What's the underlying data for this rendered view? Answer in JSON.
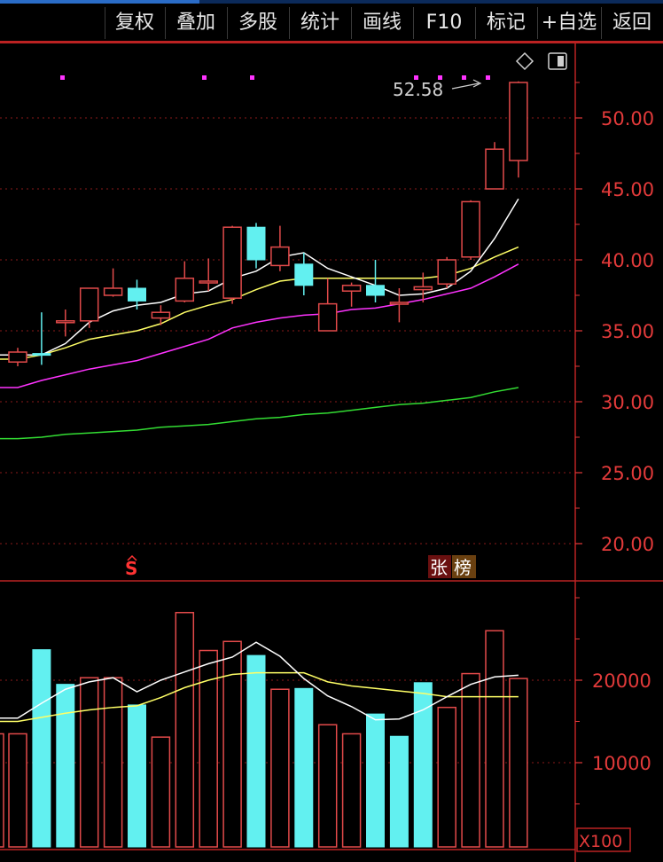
{
  "toolbar": {
    "items": [
      {
        "label": "复权",
        "name": "fuquan-button"
      },
      {
        "label": "叠加",
        "name": "overlay-button"
      },
      {
        "label": "多股",
        "name": "multi-stock-button"
      },
      {
        "label": "统计",
        "name": "statistics-button"
      },
      {
        "label": "画线",
        "name": "draw-line-button"
      },
      {
        "label": "F10",
        "name": "f10-button"
      },
      {
        "label": "标记",
        "name": "mark-button"
      },
      {
        "label": "+自选",
        "name": "add-watchlist-button"
      },
      {
        "label": "返回",
        "name": "back-button"
      }
    ]
  },
  "colors": {
    "up": "#e24a4a",
    "down": "#62f0f0",
    "axis": "#e23a3a",
    "ma1": "#ffffff",
    "ma2": "#ffff66",
    "ma3": "#ff33ff",
    "ma4": "#33dd33"
  },
  "price_panel": {
    "high_marker": "52.58",
    "tags": {
      "s_marker": "S",
      "zhang": "张",
      "bang": "榜"
    },
    "chart_data": {
      "type": "candlestick",
      "yticks": [
        "50.00",
        "45.00",
        "40.00",
        "35.00",
        "30.00",
        "25.00",
        "20.00"
      ],
      "ylim": [
        18.5,
        53.5
      ],
      "candles": [
        {
          "o": 32.8,
          "c": 33.5,
          "h": 33.8,
          "l": 32.5
        },
        {
          "o": 33.4,
          "c": 33.3,
          "h": 36.3,
          "l": 32.6
        },
        {
          "o": 35.7,
          "c": 35.7,
          "h": 36.5,
          "l": 34.6
        },
        {
          "o": 35.7,
          "c": 38.0,
          "h": 38.0,
          "l": 35.2
        },
        {
          "o": 37.5,
          "c": 38.0,
          "h": 39.4,
          "l": 37.4
        },
        {
          "o": 38.0,
          "c": 37.1,
          "h": 38.6,
          "l": 36.5
        },
        {
          "o": 35.9,
          "c": 36.3,
          "h": 36.8,
          "l": 35.4
        },
        {
          "o": 37.1,
          "c": 38.7,
          "h": 39.9,
          "l": 37.0
        },
        {
          "o": 38.5,
          "c": 38.5,
          "h": 40.1,
          "l": 37.8
        },
        {
          "o": 37.3,
          "c": 42.3,
          "h": 42.4,
          "l": 36.9
        },
        {
          "o": 42.3,
          "c": 40.0,
          "h": 42.6,
          "l": 39.4
        },
        {
          "o": 39.6,
          "c": 40.9,
          "h": 42.4,
          "l": 39.2
        },
        {
          "o": 39.7,
          "c": 38.2,
          "h": 40.5,
          "l": 37.5
        },
        {
          "o": 35.0,
          "c": 36.9,
          "h": 38.7,
          "l": 35.0
        },
        {
          "o": 37.8,
          "c": 38.2,
          "h": 38.4,
          "l": 36.7
        },
        {
          "o": 38.2,
          "c": 37.5,
          "h": 40.0,
          "l": 37.0
        },
        {
          "o": 36.9,
          "c": 37.0,
          "h": 38.0,
          "l": 35.6
        },
        {
          "o": 37.9,
          "c": 38.1,
          "h": 39.1,
          "l": 37.0
        },
        {
          "o": 38.3,
          "c": 40.0,
          "h": 40.2,
          "l": 38.0
        },
        {
          "o": 40.2,
          "c": 44.1,
          "h": 44.2,
          "l": 40.0
        },
        {
          "o": 45.0,
          "c": 47.8,
          "h": 48.3,
          "l": 45.0
        },
        {
          "o": 47.0,
          "c": 52.5,
          "h": 52.58,
          "l": 45.8
        }
      ],
      "ma_white": [
        33.3,
        33.3,
        34.1,
        35.6,
        36.4,
        36.8,
        37.0,
        37.6,
        37.8,
        38.7,
        39.2,
        40.2,
        40.5,
        39.4,
        38.8,
        38.2,
        37.5,
        37.6,
        38.0,
        39.2,
        41.5,
        44.3
      ],
      "ma_yellow": [
        33.0,
        33.3,
        33.8,
        34.4,
        34.7,
        35.0,
        35.5,
        36.3,
        36.8,
        37.2,
        37.9,
        38.5,
        38.7,
        38.7,
        38.7,
        38.7,
        38.7,
        38.7,
        38.9,
        39.4,
        40.2,
        40.9
      ],
      "ma_magenta": [
        31.0,
        31.5,
        31.9,
        32.3,
        32.6,
        32.9,
        33.4,
        33.9,
        34.4,
        35.2,
        35.6,
        35.9,
        36.1,
        36.2,
        36.5,
        36.6,
        36.9,
        37.2,
        37.6,
        38.0,
        38.8,
        39.7
      ],
      "ma_green": [
        27.4,
        27.5,
        27.7,
        27.8,
        27.9,
        28.0,
        28.2,
        28.3,
        28.4,
        28.6,
        28.8,
        28.9,
        29.1,
        29.2,
        29.4,
        29.6,
        29.8,
        29.9,
        30.1,
        30.3,
        30.7,
        31.0
      ]
    }
  },
  "volume_panel": {
    "scale_label": "X100",
    "chart_data": {
      "type": "bar",
      "yticks": [
        "20000",
        "10000"
      ],
      "ylim": [
        0,
        31000
      ],
      "bars": [
        {
          "v": 13500,
          "up": true
        },
        {
          "v": 23700,
          "up": false
        },
        {
          "v": 19500,
          "up": false
        },
        {
          "v": 20300,
          "up": true
        },
        {
          "v": 20300,
          "up": true
        },
        {
          "v": 17000,
          "up": false
        },
        {
          "v": 13100,
          "up": true
        },
        {
          "v": 28200,
          "up": true
        },
        {
          "v": 23600,
          "up": true
        },
        {
          "v": 24700,
          "up": true
        },
        {
          "v": 23000,
          "up": false
        },
        {
          "v": 18900,
          "up": true
        },
        {
          "v": 19000,
          "up": false
        },
        {
          "v": 14600,
          "up": true
        },
        {
          "v": 13500,
          "up": true
        },
        {
          "v": 15900,
          "up": false
        },
        {
          "v": 13200,
          "up": false
        },
        {
          "v": 19700,
          "up": false
        },
        {
          "v": 16700,
          "up": true
        },
        {
          "v": 20800,
          "up": true
        },
        {
          "v": 26000,
          "up": true
        },
        {
          "v": 20200,
          "up": true
        }
      ],
      "ma_white": [
        15400,
        17200,
        18900,
        19800,
        20300,
        18600,
        20000,
        21000,
        22000,
        22800,
        24600,
        22900,
        20200,
        18100,
        16800,
        15200,
        15300,
        16400,
        18000,
        19500,
        20400,
        20600
      ],
      "ma_yellow": [
        15000,
        15500,
        16000,
        16400,
        16700,
        16900,
        17900,
        19100,
        20000,
        20700,
        20900,
        20900,
        20900,
        19800,
        19300,
        19000,
        18700,
        18400,
        18000,
        18000,
        18000,
        18000
      ]
    }
  }
}
